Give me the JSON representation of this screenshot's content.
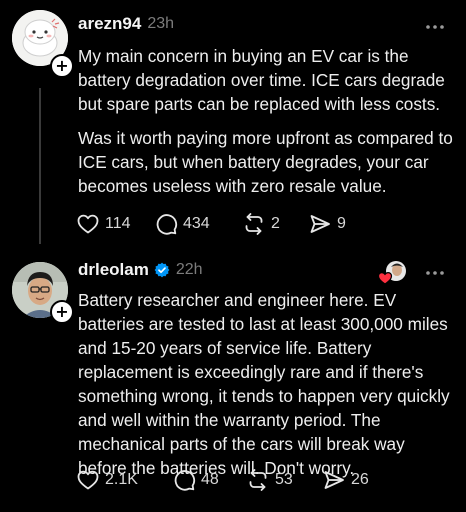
{
  "posts": [
    {
      "username": "arezn94",
      "time": "23h",
      "verified": false,
      "paragraphs": [
        "My main concern in buying an EV car is the battery degradation over time. ICE cars degrade but spare parts can be replaced with less costs.",
        "Was it worth paying more upfront as compared to ICE cars, but when battery degrades, your car becomes useless with zero resale value."
      ],
      "actions": {
        "likes": "114",
        "replies": "434",
        "reposts": "2",
        "shares": "9"
      },
      "icons": [
        "heart-icon",
        "comment-icon",
        "repost-icon",
        "share-icon",
        "more-icon"
      ]
    },
    {
      "username": "drleolam",
      "time": "22h",
      "verified": true,
      "paragraphs": [
        "Battery researcher and engineer here. EV batteries are tested to last at least 300,000 miles and 15-20 years of service life. Battery replacement is exceedingly rare and if there's something wrong, it tends to happen very quickly and well within the warranty period. The mechanical parts of the cars will break way before the batteries will. Don't worry."
      ],
      "actions": {
        "likes": "2.1K",
        "replies": "48",
        "reposts": "53",
        "shares": "26"
      },
      "icons": [
        "heart-icon",
        "comment-icon",
        "repost-icon",
        "share-icon",
        "more-icon",
        "liked-by-author-icon"
      ]
    }
  ],
  "colors": {
    "background": "#000000",
    "text": "#eeeeee",
    "muted": "#7c7c7c",
    "verified": "#0095f6",
    "reaction": "#ff3040"
  }
}
